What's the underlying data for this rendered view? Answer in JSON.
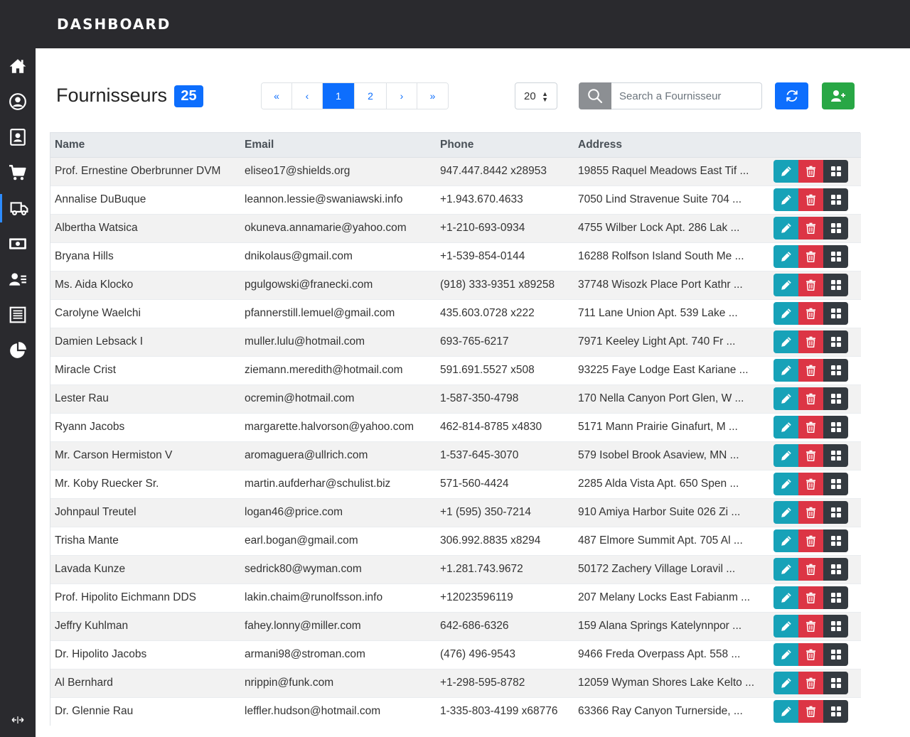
{
  "brand": "DASHBOARD",
  "sidebar": {
    "items": [
      {
        "icon": "home-icon"
      },
      {
        "icon": "user-circle-icon"
      },
      {
        "icon": "contact-card-icon"
      },
      {
        "icon": "shopping-cart-icon"
      },
      {
        "icon": "truck-icon",
        "active": true
      },
      {
        "icon": "money-icon"
      },
      {
        "icon": "user-list-icon"
      },
      {
        "icon": "receipt-icon"
      },
      {
        "icon": "pie-chart-icon"
      }
    ],
    "collapse_icon": "collapse-arrows-icon"
  },
  "page": {
    "title": "Fournisseurs",
    "count": "25"
  },
  "pagination": {
    "first": "«",
    "prev": "‹",
    "pages": [
      "1",
      "2"
    ],
    "current": "1",
    "next": "›",
    "last": "»"
  },
  "per_page": {
    "value": "20"
  },
  "search": {
    "placeholder": "Search a Fournisseur",
    "value": ""
  },
  "colors": {
    "primary": "#0d6efd",
    "success": "#28a745",
    "info": "#17a2b8",
    "danger": "#dc3545",
    "dark": "#343a40",
    "sidebar": "#2a2a2e"
  },
  "table": {
    "headers": [
      "Name",
      "Email",
      "Phone",
      "Address"
    ],
    "rows": [
      {
        "name": "Prof. Ernestine Oberbrunner DVM",
        "email": "eliseo17@shields.org",
        "phone": "947.447.8442 x28953",
        "address": "19855 Raquel Meadows East Tif ..."
      },
      {
        "name": "Annalise DuBuque",
        "email": "leannon.lessie@swaniawski.info",
        "phone": "+1.943.670.4633",
        "address": "7050 Lind Stravenue Suite 704 ..."
      },
      {
        "name": "Albertha Watsica",
        "email": "okuneva.annamarie@yahoo.com",
        "phone": "+1-210-693-0934",
        "address": "4755 Wilber Lock Apt. 286 Lak ..."
      },
      {
        "name": "Bryana Hills",
        "email": "dnikolaus@gmail.com",
        "phone": "+1-539-854-0144",
        "address": "16288 Rolfson Island South Me ..."
      },
      {
        "name": "Ms. Aida Klocko",
        "email": "pgulgowski@franecki.com",
        "phone": "(918) 333-9351 x89258",
        "address": "37748 Wisozk Place Port Kathr ..."
      },
      {
        "name": "Carolyne Waelchi",
        "email": "pfannerstill.lemuel@gmail.com",
        "phone": "435.603.0728 x222",
        "address": "711 Lane Union Apt. 539 Lake ..."
      },
      {
        "name": "Damien Lebsack I",
        "email": "muller.lulu@hotmail.com",
        "phone": "693-765-6217",
        "address": "7971 Keeley Light Apt. 740 Fr ..."
      },
      {
        "name": "Miracle Crist",
        "email": "ziemann.meredith@hotmail.com",
        "phone": "591.691.5527 x508",
        "address": "93225 Faye Lodge East Kariane ..."
      },
      {
        "name": "Lester Rau",
        "email": "ocremin@hotmail.com",
        "phone": "1-587-350-4798",
        "address": "170 Nella Canyon Port Glen, W ..."
      },
      {
        "name": "Ryann Jacobs",
        "email": "margarette.halvorson@yahoo.com",
        "phone": "462-814-8785 x4830",
        "address": "5171 Mann Prairie Ginafurt, M ..."
      },
      {
        "name": "Mr. Carson Hermiston V",
        "email": "aromaguera@ullrich.com",
        "phone": "1-537-645-3070",
        "address": "579 Isobel Brook Asaview, MN ..."
      },
      {
        "name": "Mr. Koby Ruecker Sr.",
        "email": "martin.aufderhar@schulist.biz",
        "phone": "571-560-4424",
        "address": "2285 Alda Vista Apt. 650 Spen ..."
      },
      {
        "name": "Johnpaul Treutel",
        "email": "logan46@price.com",
        "phone": "+1 (595) 350-7214",
        "address": "910 Amiya Harbor Suite 026 Zi ..."
      },
      {
        "name": "Trisha Mante",
        "email": "earl.bogan@gmail.com",
        "phone": "306.992.8835 x8294",
        "address": "487 Elmore Summit Apt. 705 Al ..."
      },
      {
        "name": "Lavada Kunze",
        "email": "sedrick80@wyman.com",
        "phone": "+1.281.743.9672",
        "address": "50172 Zachery Village Loravil ..."
      },
      {
        "name": "Prof. Hipolito Eichmann DDS",
        "email": "lakin.chaim@runolfsson.info",
        "phone": "+12023596119",
        "address": "207 Melany Locks East Fabianm ..."
      },
      {
        "name": "Jeffry Kuhlman",
        "email": "fahey.lonny@miller.com",
        "phone": "642-686-6326",
        "address": "159 Alana Springs Katelynnpor ..."
      },
      {
        "name": "Dr. Hipolito Jacobs",
        "email": "armani98@stroman.com",
        "phone": "(476) 496-9543",
        "address": "9466 Freda Overpass Apt. 558 ..."
      },
      {
        "name": "Al Bernhard",
        "email": "nrippin@funk.com",
        "phone": "+1-298-595-8782",
        "address": "12059 Wyman Shores Lake Kelto ..."
      },
      {
        "name": "Dr. Glennie Rau",
        "email": "leffler.hudson@hotmail.com",
        "phone": "1-335-803-4199 x68776",
        "address": "63366 Ray Canyon Turnerside, ..."
      }
    ],
    "row_actions": [
      "edit-icon",
      "trash-icon",
      "grid-icon"
    ]
  }
}
